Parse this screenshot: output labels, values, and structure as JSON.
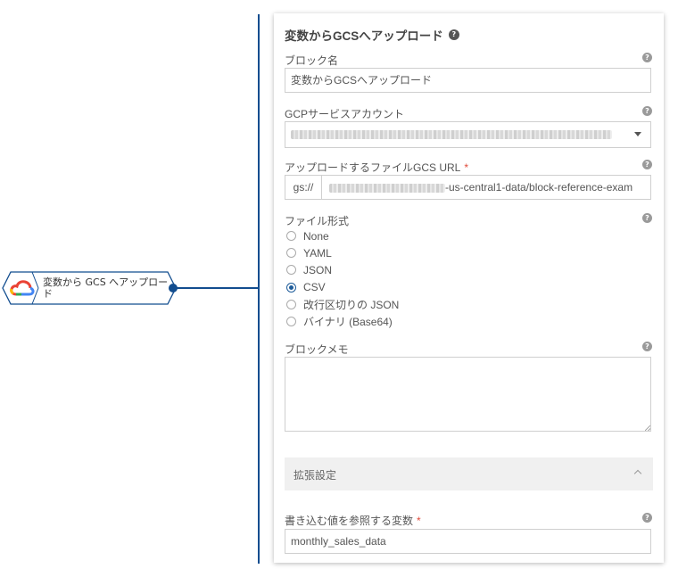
{
  "flow": {
    "node_label": "変数から GCS へアップロード"
  },
  "panel": {
    "title": "変数からGCSへアップロード",
    "block_name": {
      "label": "ブロック名",
      "value": "変数からGCSへアップロード"
    },
    "service_account": {
      "label": "GCPサービスアカウント",
      "value_redacted": true
    },
    "gcs_url": {
      "label": "アップロードするファイルGCS URL",
      "required_mark": "*",
      "prefix": "gs://",
      "value_visible": "-us-central1-data/block-reference-exam"
    },
    "file_format": {
      "label": "ファイル形式",
      "options": [
        "None",
        "YAML",
        "JSON",
        "CSV",
        "改行区切りの JSON",
        "バイナリ (Base64)"
      ],
      "selected": "CSV"
    },
    "memo": {
      "label": "ブロックメモ",
      "value": ""
    },
    "advanced": {
      "label": "拡張設定"
    },
    "variable": {
      "label": "書き込む値を参照する変数",
      "required_mark": "*",
      "value": "monthly_sales_data"
    },
    "help_icon": "?"
  },
  "colors": {
    "connector": "#124d8f",
    "accent": "#1e5c9a",
    "required": "#e04a3a"
  },
  "icons": [
    "google-cloud-logo",
    "help-icon",
    "chevron-down-icon",
    "chevron-up-icon"
  ]
}
